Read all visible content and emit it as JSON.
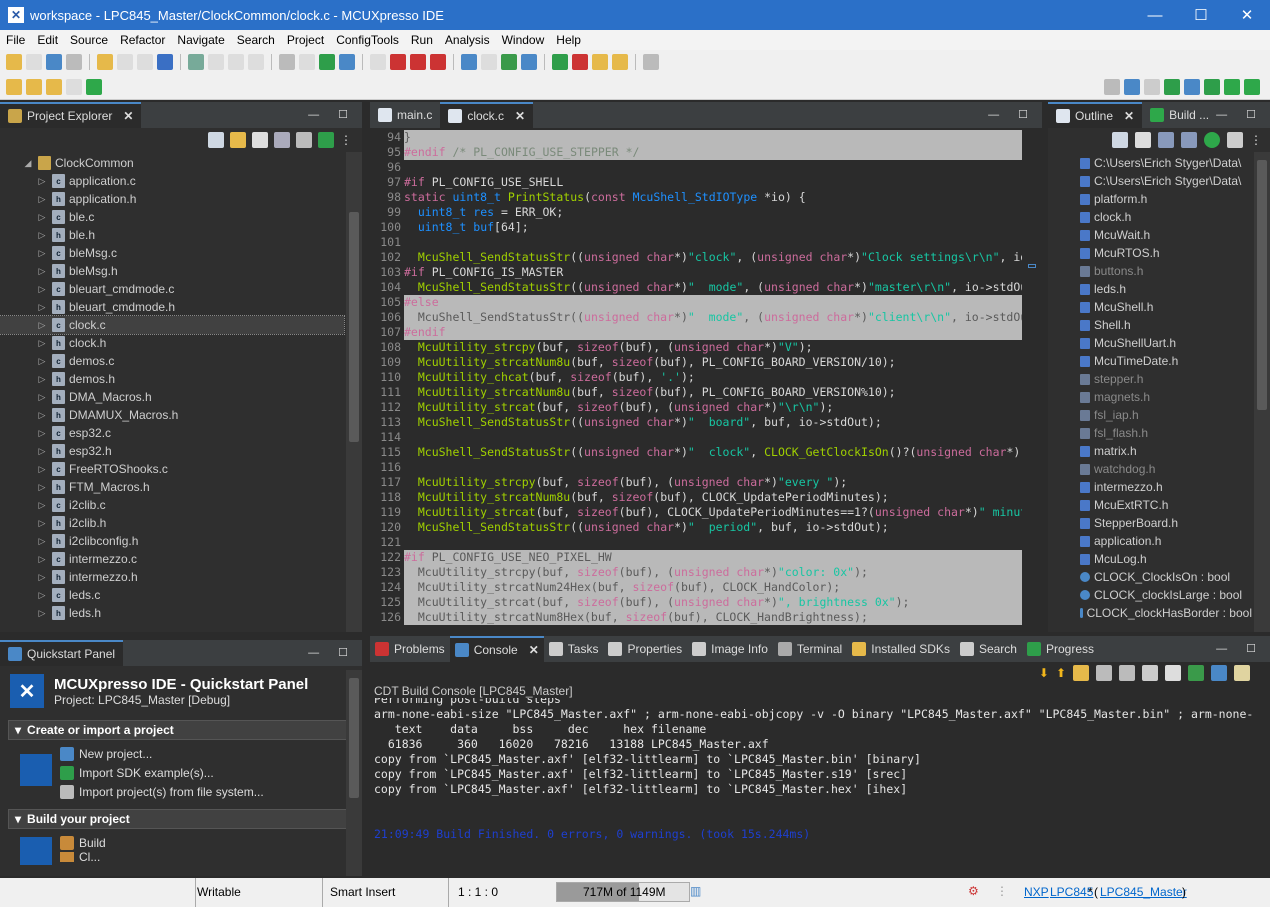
{
  "window": {
    "title": "workspace - LPC845_Master/ClockCommon/clock.c - MCUXpresso IDE"
  },
  "menu": [
    "File",
    "Edit",
    "Source",
    "Refactor",
    "Navigate",
    "Search",
    "Project",
    "ConfigTools",
    "Run",
    "Analysis",
    "Window",
    "Help"
  ],
  "project_explorer": {
    "tab_label": "Project Explorer",
    "root": "ClockCommon",
    "files": [
      "application.c",
      "application.h",
      "ble.c",
      "ble.h",
      "bleMsg.c",
      "bleMsg.h",
      "bleuart_cmdmode.c",
      "bleuart_cmdmode.h",
      "clock.c",
      "clock.h",
      "demos.c",
      "demos.h",
      "DMA_Macros.h",
      "DMAMUX_Macros.h",
      "esp32.c",
      "esp32.h",
      "FreeRTOShooks.c",
      "FTM_Macros.h",
      "i2clib.c",
      "i2clib.h",
      "i2clibconfig.h",
      "intermezzo.c",
      "intermezzo.h",
      "leds.c",
      "leds.h"
    ],
    "selected": "clock.c"
  },
  "editor": {
    "tabs": [
      "main.c",
      "clock.c"
    ],
    "active_tab": "clock.c",
    "lines": [
      {
        "n": "94",
        "html": "}",
        "inactive": true
      },
      {
        "n": "95",
        "html": "<span class='pp'>#endif</span> <span class='cm'>/* PL_CONFIG_USE_STEPPER */</span>",
        "inactive": true
      },
      {
        "n": "96",
        "html": "",
        "inactive": false
      },
      {
        "n": "97",
        "html": "<span class='pp'>#if</span> PL_CONFIG_USE_SHELL",
        "inactive": false
      },
      {
        "n": "98",
        "html": "<span class='kw'>static</span> <span class='tp'>uint8_t</span> <span class='fn'>PrintStatus</span>(<span class='kw'>const</span> <span class='tp'>McuShell_StdIOType</span> *io) {",
        "inactive": false
      },
      {
        "n": "99",
        "html": "  <span class='tp'>uint8_t</span> <span class='tp'>res</span> = ERR_OK;",
        "inactive": false
      },
      {
        "n": "100",
        "html": "  <span class='tp'>uint8_t</span> <span class='tp'>buf</span>[64];",
        "inactive": false
      },
      {
        "n": "101",
        "html": "",
        "inactive": false
      },
      {
        "n": "102",
        "html": "  <span class='fn'>McuShell_SendStatusStr</span>((<span class='kw'>unsigned char</span>*)<span class='st'>\"clock\"</span>, (<span class='kw'>unsigned char</span>*)<span class='st'>\"Clock settings\\r\\n\"</span>, io->stdOut);",
        "inactive": false
      },
      {
        "n": "103",
        "html": "<span class='pp'>#if</span> PL_CONFIG_IS_MASTER",
        "inactive": false
      },
      {
        "n": "104",
        "html": "  <span class='fn'>McuShell_SendStatusStr</span>((<span class='kw'>unsigned char</span>*)<span class='st'>\"  mode\"</span>, (<span class='kw'>unsigned char</span>*)<span class='st'>\"master\\r\\n\"</span>, io->stdOut);",
        "inactive": false
      },
      {
        "n": "105",
        "html": "<span class='pp'>#else</span>",
        "inactive": true
      },
      {
        "n": "106",
        "html": "  McuShell_SendStatusStr((<span class='kw'>unsigned char</span>*)<span class='st'>\"  mode\"</span>, (<span class='kw'>unsigned char</span>*)<span class='st'>\"client\\r\\n\"</span>, io->stdOut);",
        "inactive": true
      },
      {
        "n": "107",
        "html": "<span class='pp'>#endif</span>",
        "inactive": true
      },
      {
        "n": "108",
        "html": "  <span class='fn'>McuUtility_strcpy</span>(buf, <span class='kw'>sizeof</span>(buf), (<span class='kw'>unsigned char</span>*)<span class='st'>\"V\"</span>);",
        "inactive": false
      },
      {
        "n": "109",
        "html": "  <span class='fn'>McuUtility_strcatNum8u</span>(buf, <span class='kw'>sizeof</span>(buf), PL_CONFIG_BOARD_VERSION/10);",
        "inactive": false
      },
      {
        "n": "110",
        "html": "  <span class='fn'>McuUtility_chcat</span>(buf, <span class='kw'>sizeof</span>(buf), <span class='st'>'.'</span>);",
        "inactive": false
      },
      {
        "n": "111",
        "html": "  <span class='fn'>McuUtility_strcatNum8u</span>(buf, <span class='kw'>sizeof</span>(buf), PL_CONFIG_BOARD_VERSION%10);",
        "inactive": false
      },
      {
        "n": "112",
        "html": "  <span class='fn'>McuUtility_strcat</span>(buf, <span class='kw'>sizeof</span>(buf), (<span class='kw'>unsigned char</span>*)<span class='st'>\"\\r\\n\"</span>);",
        "inactive": false
      },
      {
        "n": "113",
        "html": "  <span class='fn'>McuShell_SendStatusStr</span>((<span class='kw'>unsigned char</span>*)<span class='st'>\"  board\"</span>, buf, io->stdOut);",
        "inactive": false
      },
      {
        "n": "114",
        "html": "",
        "inactive": false
      },
      {
        "n": "115",
        "html": "  <span class='fn'>McuShell_SendStatusStr</span>((<span class='kw'>unsigned char</span>*)<span class='st'>\"  clock\"</span>, <span class='fn'>CLOCK_GetClockIsOn</span>()?(<span class='kw'>unsigned char</span>*)<span class='st'>\"on\"</span>",
        "inactive": false
      },
      {
        "n": "116",
        "html": "",
        "inactive": false
      },
      {
        "n": "117",
        "html": "  <span class='fn'>McuUtility_strcpy</span>(buf, <span class='kw'>sizeof</span>(buf), (<span class='kw'>unsigned char</span>*)<span class='st'>\"every \"</span>);",
        "inactive": false
      },
      {
        "n": "118",
        "html": "  <span class='fn'>McuUtility_strcatNum8u</span>(buf, <span class='kw'>sizeof</span>(buf), CLOCK_UpdatePeriodMinutes);",
        "inactive": false
      },
      {
        "n": "119",
        "html": "  <span class='fn'>McuUtility_strcat</span>(buf, <span class='kw'>sizeof</span>(buf), CLOCK_UpdatePeriodMinutes==1?(<span class='kw'>unsigned char</span>*)<span class='st'>\" minute\"</span>",
        "inactive": false
      },
      {
        "n": "120",
        "html": "  <span class='fn'>McuShell_SendStatusStr</span>((<span class='kw'>unsigned char</span>*)<span class='st'>\"  period\"</span>, buf, io->stdOut);",
        "inactive": false
      },
      {
        "n": "121",
        "html": "",
        "inactive": false
      },
      {
        "n": "122",
        "html": "<span class='pp'>#if</span> PL_CONFIG_USE_NEO_PIXEL_HW",
        "inactive": true
      },
      {
        "n": "123",
        "html": "  McuUtility_strcpy(buf, <span class='kw'>sizeof</span>(buf), (<span class='kw'>unsigned char</span>*)<span class='st'>\"color: 0x\"</span>);",
        "inactive": true
      },
      {
        "n": "124",
        "html": "  McuUtility_strcatNum24Hex(buf, <span class='kw'>sizeof</span>(buf), CLOCK_HandColor);",
        "inactive": true
      },
      {
        "n": "125",
        "html": "  McuUtility_strcat(buf, <span class='kw'>sizeof</span>(buf), (<span class='kw'>unsigned char</span>*)<span class='st'>\", brightness 0x\"</span>);",
        "inactive": true
      },
      {
        "n": "126",
        "html": "  McuUtility_strcatNum8Hex(buf, <span class='kw'>sizeof</span>(buf), CLOCK_HandBrightness);",
        "inactive": true
      }
    ]
  },
  "outline": {
    "tabs": [
      "Outline",
      "Build ..."
    ],
    "items": [
      {
        "label": "C:\\Users\\Erich Styger\\Data\\",
        "kind": "inc"
      },
      {
        "label": "C:\\Users\\Erich Styger\\Data\\",
        "kind": "inc"
      },
      {
        "label": "platform.h",
        "kind": "inc"
      },
      {
        "label": "clock.h",
        "kind": "inc"
      },
      {
        "label": "McuWait.h",
        "kind": "inc"
      },
      {
        "label": "McuRTOS.h",
        "kind": "inc"
      },
      {
        "label": "buttons.h",
        "kind": "incx"
      },
      {
        "label": "leds.h",
        "kind": "inc"
      },
      {
        "label": "McuShell.h",
        "kind": "inc"
      },
      {
        "label": "Shell.h",
        "kind": "inc"
      },
      {
        "label": "McuShellUart.h",
        "kind": "inc"
      },
      {
        "label": "McuTimeDate.h",
        "kind": "inc"
      },
      {
        "label": "stepper.h",
        "kind": "incx"
      },
      {
        "label": "magnets.h",
        "kind": "incx"
      },
      {
        "label": "fsl_iap.h",
        "kind": "incx"
      },
      {
        "label": "fsl_flash.h",
        "kind": "incx"
      },
      {
        "label": "matrix.h",
        "kind": "inc"
      },
      {
        "label": "watchdog.h",
        "kind": "incx"
      },
      {
        "label": "intermezzo.h",
        "kind": "inc"
      },
      {
        "label": "McuExtRTC.h",
        "kind": "inc"
      },
      {
        "label": "StepperBoard.h",
        "kind": "inc"
      },
      {
        "label": "application.h",
        "kind": "inc"
      },
      {
        "label": "McuLog.h",
        "kind": "inc"
      },
      {
        "label": "CLOCK_ClockIsOn : bool",
        "kind": "var"
      },
      {
        "label": "CLOCK_clockIsLarge : bool",
        "kind": "var"
      },
      {
        "label": "CLOCK_clockHasBorder : bool",
        "kind": "var"
      }
    ]
  },
  "quickstart": {
    "tab_label": "Quickstart Panel",
    "title": "MCUXpresso IDE - Quickstart Panel",
    "project_line": "Project: LPC845_Master [Debug]",
    "sec1": "Create or import a project",
    "sec1_items": [
      "New project...",
      "Import SDK example(s)...",
      "Import project(s) from file system..."
    ],
    "sec2": "Build your project",
    "sec2_items": [
      "Build",
      "Cl..."
    ]
  },
  "bottom": {
    "tabs": [
      "Problems",
      "Console",
      "Tasks",
      "Properties",
      "Image Info",
      "Terminal",
      "Installed SDKs",
      "Search",
      "Progress"
    ],
    "active_tab": "Console",
    "console_title": "CDT Build Console [LPC845_Master]",
    "lines": [
      "Performing post-build steps",
      "arm-none-eabi-size \"LPC845_Master.axf\" ; arm-none-eabi-objcopy -v -O binary \"LPC845_Master.axf\" \"LPC845_Master.bin\" ; arm-none-",
      "   text    data     bss     dec     hex filename",
      "  61836     360   16020   78216   13188 LPC845_Master.axf",
      "copy from `LPC845_Master.axf' [elf32-littlearm] to `LPC845_Master.bin' [binary]",
      "copy from `LPC845_Master.axf' [elf32-littlearm] to `LPC845_Master.s19' [srec]",
      "copy from `LPC845_Master.axf' [elf32-littlearm] to `LPC845_Master.hex' [ihex]"
    ],
    "finish_line": "21:09:49 Build Finished. 0 errors, 0 warnings. (took 15s.244ms)"
  },
  "status": {
    "writable": "Writable",
    "insert": "Smart Insert",
    "pos": "1 : 1 : 0",
    "memory": "717M of 1149M",
    "memory_used_fraction": 0.62,
    "nxp": "NXP",
    "chip": "LPC845",
    "star": "*",
    "project": "LPC845_Master"
  }
}
